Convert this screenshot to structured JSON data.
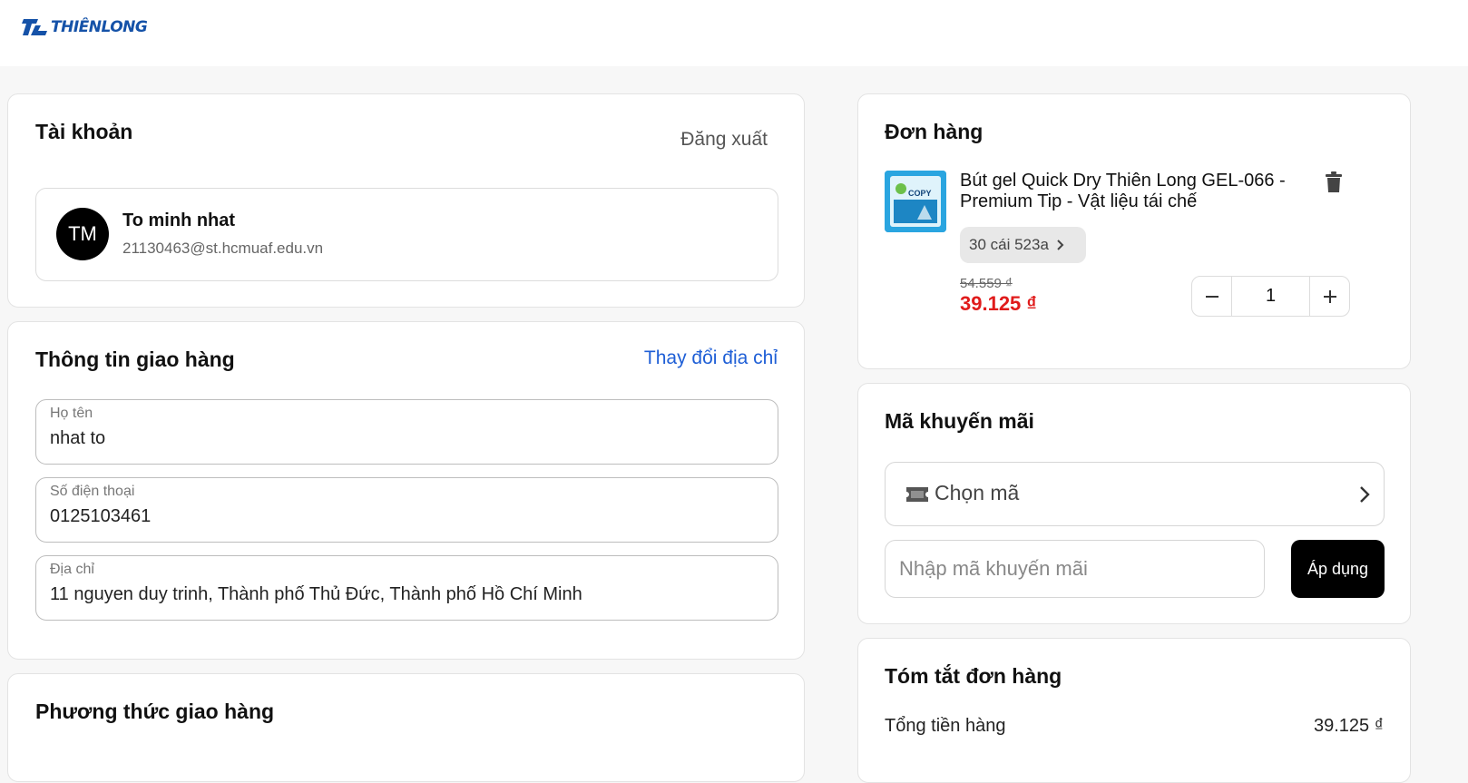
{
  "brand": {
    "logo_text": "THIÊNLONG",
    "color": "#1552a8"
  },
  "account": {
    "title": "Tài khoản",
    "logout_label": "Đăng xuất",
    "avatar_initials": "TM",
    "name": "To minh nhat",
    "email": "21130463@st.hcmuaf.edu.vn"
  },
  "shipping_info": {
    "title": "Thông tin giao hàng",
    "change_address_label": "Thay đổi địa chỉ",
    "fields": [
      {
        "label": "Họ tên",
        "value": "nhat to"
      },
      {
        "label": "Số điện thoại",
        "value": "0125103461"
      },
      {
        "label": "Địa chỉ",
        "value": "11 nguyen duy trinh, Thành phố Thủ Đức, Thành phố Hồ Chí Minh"
      }
    ]
  },
  "shipping_method": {
    "title": "Phương thức giao hàng"
  },
  "order": {
    "title": "Đơn hàng",
    "item": {
      "name": "Bút gel Quick Dry Thiên Long GEL-066 - Premium Tip - Vật liệu tái chế",
      "image_text": "COPY",
      "variant": "30 cái 523a",
      "old_price": "54.559 ₫",
      "price": "39.125 ₫",
      "quantity": "1",
      "price_color": "#e01b1b"
    }
  },
  "promo": {
    "title": "Mã khuyến mãi",
    "select_label": "Chọn mã",
    "input_placeholder": "Nhập mã khuyến mãi",
    "apply_label": "Áp dụng"
  },
  "summary": {
    "title": "Tóm tắt đơn hàng",
    "subtotal_label": "Tổng tiền hàng",
    "subtotal_value": "39.125 ₫"
  }
}
